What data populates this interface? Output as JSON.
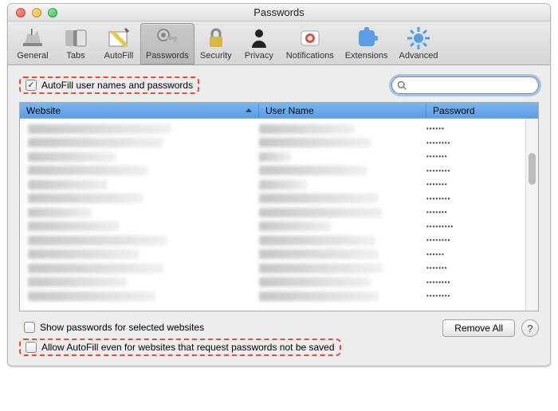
{
  "window": {
    "title": "Passwords"
  },
  "toolbar": {
    "items": [
      {
        "label": "General",
        "icon": "general-icon",
        "selected": false
      },
      {
        "label": "Tabs",
        "icon": "tabs-icon",
        "selected": false
      },
      {
        "label": "AutoFill",
        "icon": "autofill-icon",
        "selected": false
      },
      {
        "label": "Passwords",
        "icon": "passwords-icon",
        "selected": true
      },
      {
        "label": "Security",
        "icon": "security-icon",
        "selected": false
      },
      {
        "label": "Privacy",
        "icon": "privacy-icon",
        "selected": false
      },
      {
        "label": "Notifications",
        "icon": "notifications-icon",
        "selected": false
      },
      {
        "label": "Extensions",
        "icon": "extensions-icon",
        "selected": false
      },
      {
        "label": "Advanced",
        "icon": "advanced-icon",
        "selected": false
      }
    ]
  },
  "options": {
    "autofill_label": "AutoFill user names and passwords",
    "autofill_checked": true,
    "show_passwords_label": "Show passwords for selected websites",
    "show_passwords_checked": false,
    "allow_autofill_label": "Allow AutoFill even for websites that request passwords not be saved",
    "allow_autofill_checked": false
  },
  "search": {
    "placeholder": "",
    "value": ""
  },
  "table": {
    "columns": {
      "website": "Website",
      "username": "User Name",
      "password": "Password"
    },
    "sort_column": "website",
    "sort_dir": "asc",
    "rows": [
      {
        "web_w": 180,
        "user_w": 120,
        "pass": "••••••"
      },
      {
        "web_w": 170,
        "user_w": 140,
        "pass": "••••••••"
      },
      {
        "web_w": 110,
        "user_w": 40,
        "pass": "•••••••"
      },
      {
        "web_w": 150,
        "user_w": 135,
        "pass": "••••••••"
      },
      {
        "web_w": 100,
        "user_w": 60,
        "pass": "•••••••"
      },
      {
        "web_w": 145,
        "user_w": 150,
        "pass": "••••••••"
      },
      {
        "web_w": 80,
        "user_w": 155,
        "pass": "•••••••"
      },
      {
        "web_w": 115,
        "user_w": 90,
        "pass": "•••••••••"
      },
      {
        "web_w": 175,
        "user_w": 145,
        "pass": "••••••••"
      },
      {
        "web_w": 140,
        "user_w": 150,
        "pass": "••••••"
      },
      {
        "web_w": 170,
        "user_w": 155,
        "pass": "•••••••"
      },
      {
        "web_w": 125,
        "user_w": 140,
        "pass": "••••••••"
      },
      {
        "web_w": 160,
        "user_w": 150,
        "pass": "••••••••"
      }
    ]
  },
  "actions": {
    "remove_all": "Remove All"
  }
}
